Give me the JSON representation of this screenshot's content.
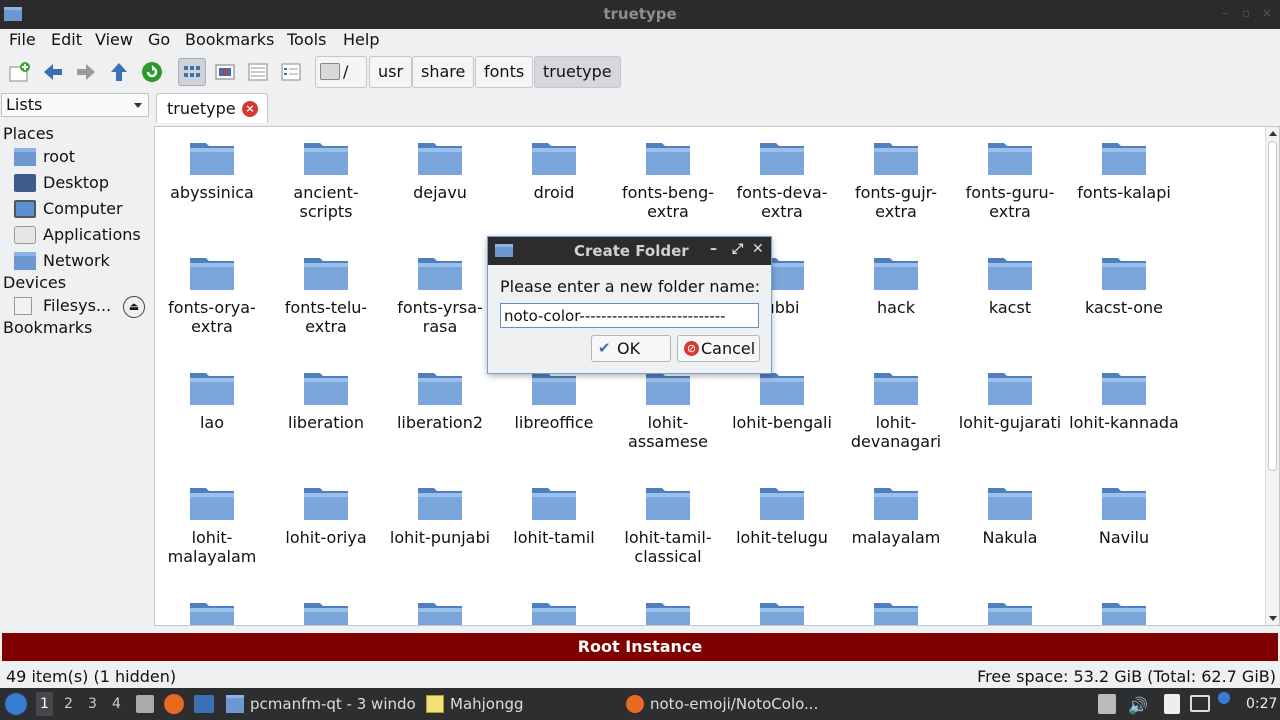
{
  "window": {
    "title": "truetype"
  },
  "menu": [
    "File",
    "Edit",
    "View",
    "Go",
    "Bookmarks",
    "Tools",
    "Help"
  ],
  "breadcrumb": [
    "/",
    "usr",
    "share",
    "fonts",
    "truetype"
  ],
  "side_panel": {
    "selector": "Lists",
    "places_header": "Places",
    "places": [
      "root",
      "Desktop",
      "Computer",
      "Applications",
      "Network"
    ],
    "devices_header": "Devices",
    "devices": [
      "Filesys..."
    ],
    "bookmarks_header": "Bookmarks"
  },
  "tab": {
    "label": "truetype"
  },
  "folders": [
    "abyssinica",
    "ancient-scripts",
    "dejavu",
    "droid",
    "fonts-beng-extra",
    "fonts-deva-extra",
    "fonts-gujr-extra",
    "fonts-guru-extra",
    "fonts-kalapi",
    "fonts-orya-extra",
    "fonts-telu-extra",
    "fonts-yrsa-rasa",
    "",
    "",
    "ubbi",
    "hack",
    "kacst",
    "kacst-one",
    "lao",
    "liberation",
    "liberation2",
    "libreoffice",
    "lohit-assamese",
    "lohit-bengali",
    "lohit-devanagari",
    "lohit-gujarati",
    "lohit-kannada",
    "lohit-malayalam",
    "lohit-oriya",
    "lohit-punjabi",
    "lohit-tamil",
    "lohit-tamil-classical",
    "lohit-telugu",
    "malayalam",
    "Nakula",
    "Navilu",
    "",
    "",
    "",
    "",
    "",
    "",
    "",
    "",
    ""
  ],
  "root_banner": "Root Instance",
  "status": {
    "items": "49 item(s) (1 hidden)",
    "free": "Free space: 53.2 GiB (Total: 62.7 GiB)"
  },
  "dialog": {
    "title": "Create Folder",
    "prompt": "Please enter a new folder name:",
    "value": "noto-color---------------------------",
    "ok": "OK",
    "cancel": "Cancel"
  },
  "taskbar": {
    "desktops": [
      "1",
      "2",
      "3",
      "4"
    ],
    "tasks": [
      "pcmanfm-qt - 3 windo...",
      "Mahjongg",
      "noto-emoji/NotoColo..."
    ],
    "clock": "0:27"
  },
  "colors": {
    "accent": "#5b8fd0",
    "banner": "#800000",
    "folder": "#6d98cf"
  }
}
